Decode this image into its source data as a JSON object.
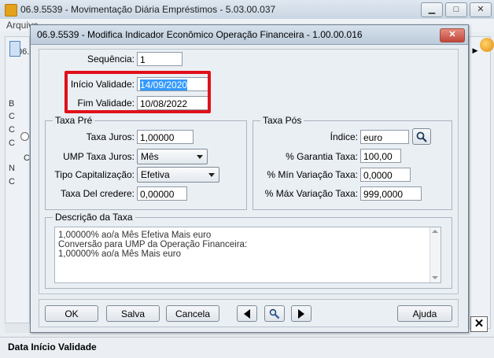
{
  "main_window": {
    "title": "06.9.5539 - Movimentação Diária Empréstimos - 5.03.00.037",
    "menu": [
      "Arquivo"
    ],
    "status_text": "Data Início Validade",
    "side_letters": [
      "B",
      "C",
      "C",
      "C",
      "C",
      "N",
      "C"
    ],
    "frag_06": "06."
  },
  "dialog": {
    "title": "06.9.5539 - Modifica Indicador Econômico Operação Financeira - 1.00.00.016",
    "close_label": "✕",
    "sequencia_label": "Sequência:",
    "sequencia_value": "1",
    "inicio_label": "Início Validade:",
    "inicio_value": "14/09/2020",
    "fim_label": "Fim Validade:",
    "fim_value": "10/08/2022",
    "taxa_pre": {
      "title": "Taxa Pré",
      "taxa_juros_label": "Taxa Juros:",
      "taxa_juros_value": "1,00000",
      "ump_label": "UMP Taxa Juros:",
      "ump_value": "Mês",
      "tipo_cap_label": "Tipo Capitalização:",
      "tipo_cap_value": "Efetiva",
      "del_credere_label": "Taxa Del credere:",
      "del_credere_value": "0,00000"
    },
    "taxa_pos": {
      "title": "Taxa Pós",
      "indice_label": "Índice:",
      "indice_value": "euro",
      "garantia_label": "% Garantia Taxa:",
      "garantia_value": "100,00",
      "min_label": "% Mín Variação Taxa:",
      "min_value": "0,0000",
      "max_label": "% Máx Variação Taxa:",
      "max_value": "999,0000"
    },
    "descricao": {
      "title": "Descrição da Taxa",
      "lines": [
        "1,00000% ao/a Mês Efetiva  Mais euro",
        "Conversão para UMP da Operação Financeira:",
        "1,00000% ao/a Mês Mais euro"
      ]
    },
    "buttons": {
      "ok": "OK",
      "salva": "Salva",
      "cancela": "Cancela",
      "ajuda": "Ajuda"
    }
  },
  "colors": {
    "highlight": "#e0101a",
    "selection": "#3399ff"
  }
}
